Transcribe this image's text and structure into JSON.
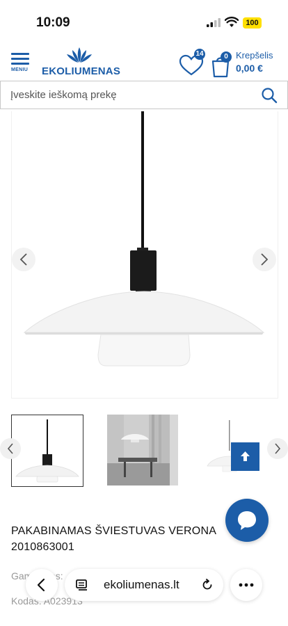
{
  "status_bar": {
    "time": "10:09",
    "battery": "100"
  },
  "header": {
    "menu_label": "MENIU",
    "logo_text": "EKOLIUMENAS",
    "wishlist_count": "14",
    "cart_count": "0",
    "cart_label": "Krepšelis",
    "cart_total": "0,00 €"
  },
  "search": {
    "placeholder": "Įveskite ieškomą prekę"
  },
  "product": {
    "title": "PAKABINAMAS ŠVIESTUVAS VERONA 2010863001",
    "manufacturer_label": "Gamintojas:",
    "code_label": "Kodas:",
    "code_value": "A023913"
  },
  "browser": {
    "url": "ekoliumenas.lt"
  },
  "colors": {
    "brand": "#1c5da8",
    "battery": "#ffe000"
  },
  "icons": [
    "menu-icon",
    "logo-flower-icon",
    "heart-icon",
    "cart-icon",
    "search-icon",
    "chevron-left-icon",
    "chevron-right-icon",
    "arrow-up-icon",
    "chat-icon",
    "tabs-icon",
    "reload-icon",
    "more-icon"
  ]
}
